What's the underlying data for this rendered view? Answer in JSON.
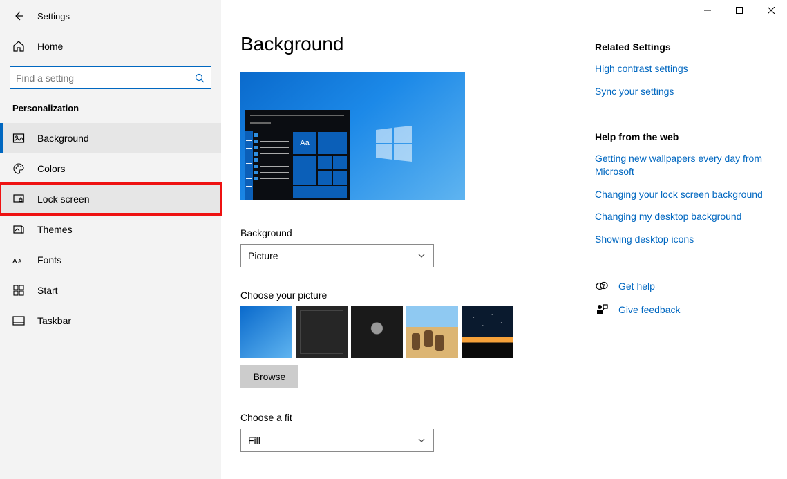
{
  "window": {
    "title": "Settings"
  },
  "sidebar": {
    "home": "Home",
    "search_placeholder": "Find a setting",
    "section": "Personalization",
    "items": [
      {
        "label": "Background"
      },
      {
        "label": "Colors"
      },
      {
        "label": "Lock screen"
      },
      {
        "label": "Themes"
      },
      {
        "label": "Fonts"
      },
      {
        "label": "Start"
      },
      {
        "label": "Taskbar"
      }
    ]
  },
  "main": {
    "title": "Background",
    "preview_sample": "Aa",
    "background_label": "Background",
    "background_value": "Picture",
    "choose_picture_label": "Choose your picture",
    "browse": "Browse",
    "choose_fit_label": "Choose a fit",
    "fit_value": "Fill"
  },
  "rail": {
    "related_header": "Related Settings",
    "links_related": [
      "High contrast settings",
      "Sync your settings"
    ],
    "help_header": "Help from the web",
    "links_help": [
      "Getting new wallpapers every day from Microsoft",
      "Changing your lock screen background",
      "Changing my desktop background",
      "Showing desktop icons"
    ],
    "get_help": "Get help",
    "give_feedback": "Give feedback"
  }
}
